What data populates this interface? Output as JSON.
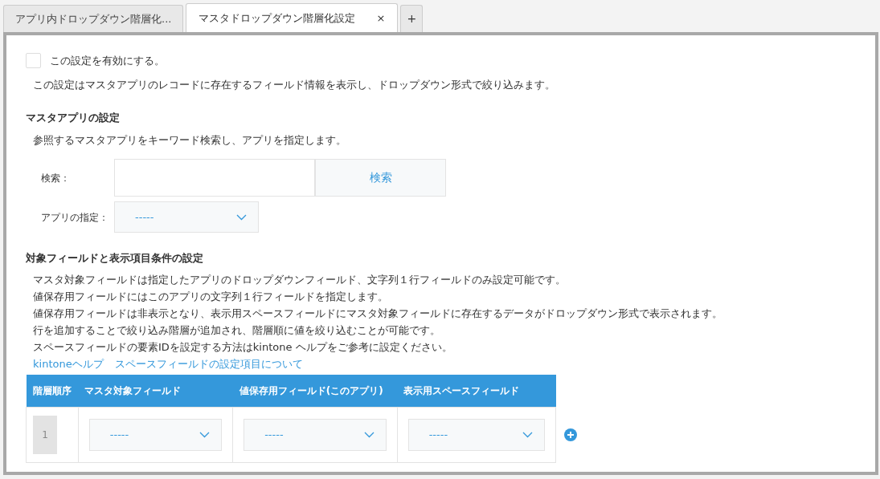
{
  "tabs": [
    {
      "label": "アプリ内ドロップダウン階層化...",
      "selected": false
    },
    {
      "label": "マスタドロップダウン階層化設定",
      "selected": true,
      "close": "×"
    }
  ],
  "add_tab": "+",
  "enable": {
    "label": "この設定を有効にする。",
    "checked": false
  },
  "enable_description": "この設定はマスタアプリのレコードに存在するフィールド情報を表示し、ドロップダウン形式で絞り込みます。",
  "master_section": {
    "heading": "マスタアプリの設定",
    "description": "参照するマスタアプリをキーワード検索し、アプリを指定します。",
    "search_label": "検索：",
    "search_button": "検索",
    "app_label": "アプリの指定：",
    "app_select": "-----"
  },
  "field_section": {
    "heading": "対象フィールドと表示項目条件の設定",
    "lines": [
      "マスタ対象フィールドは指定したアプリのドロップダウンフィールド、文字列１行フィールドのみ設定可能です。",
      "値保存用フィールドにはこのアプリの文字列１行フィールドを指定します。",
      "値保存用フィールドは非表示となり、表示用スペースフィールドにマスタ対象フィールドに存在するデータがドロップダウン形式で表示されます。",
      "行を追加することで絞り込み階層が追加され、階層順に値を絞り込むことが可能です。",
      "スペースフィールドの要素IDを設定する方法はkintone ヘルプをご参考に設定ください。"
    ],
    "links": [
      "kintoneヘルプ",
      "スペースフィールドの設定項目について"
    ]
  },
  "table": {
    "columns": [
      "階層順序",
      "マスタ対象フィールド",
      "値保存用フィールド(このアプリ)",
      "表示用スペースフィールド"
    ],
    "rows": [
      {
        "order": "1",
        "master_field": "-----",
        "save_field": "-----",
        "space_field": "-----"
      }
    ]
  }
}
